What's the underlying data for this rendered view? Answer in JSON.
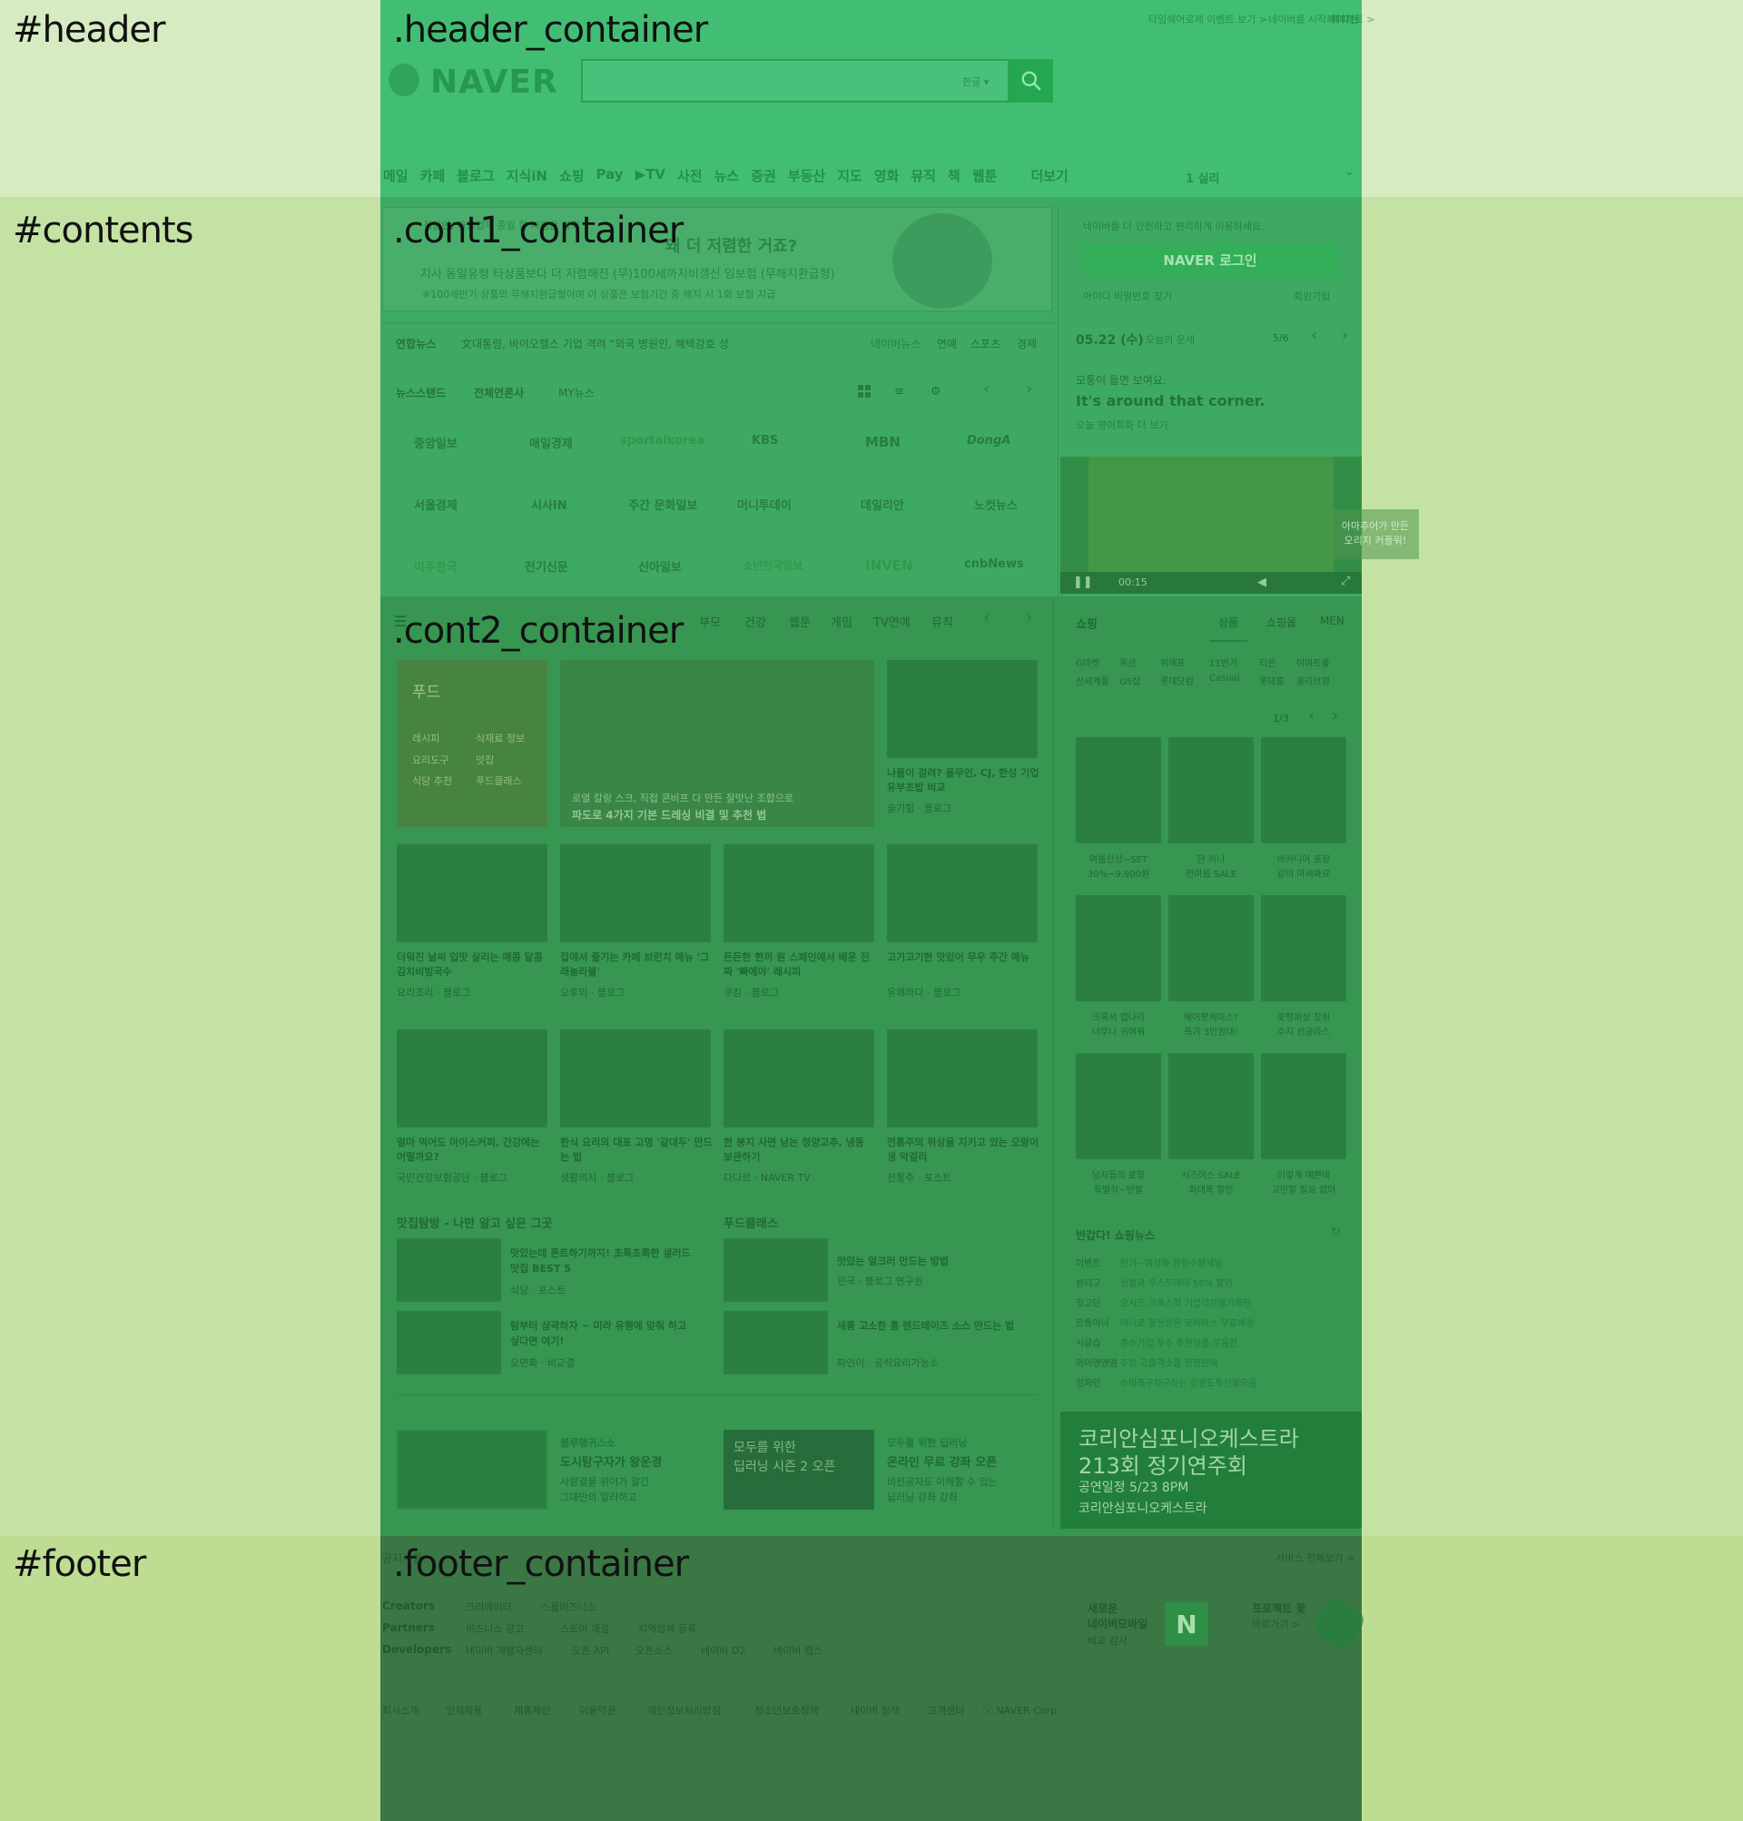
{
  "regions": {
    "header": "#header",
    "header_container": ".header_container",
    "contents": "#contents",
    "cont1_container": ".cont1_container",
    "cont2_container": ".cont2_container",
    "footer": "#footer",
    "footer_container": ".footer_container"
  },
  "colors": {
    "header_band": "#d6ebc1",
    "contents_band": "#c4e2a3",
    "footer_band": "#bedd93",
    "header_container": "#41be74",
    "cont1_container": "#3ea963",
    "cont2_container": "#379652",
    "footer_container": "#3a7745"
  },
  "header": {
    "top_links": [
      "타임쉐어로제 이벤트 보기 >",
      "네이버를 시작페이지로 >",
      "쥬니어네이버",
      "해피빈"
    ],
    "logo": "NAVER",
    "search_dropdown": "한글",
    "nav": [
      "메일",
      "카페",
      "블로그",
      "지식iN",
      "쇼핑",
      "Pay",
      "▶TV",
      "사전",
      "뉴스",
      "증권",
      "부동산",
      "지도",
      "영화",
      "뮤직",
      "책",
      "웹툰",
      "더보기"
    ],
    "nav_right": "1  실리"
  },
  "cont1": {
    "ad": {
      "line1": "직장인, 자영업자 종일 할 저렴한 가격",
      "line2": "왜 더 저렴한 거죠?",
      "line3": "지사 동일유형 타상품보다 더 저렴해진 (무)100세까지비갱신 임보험 (무해지환급형)",
      "line4": "※100세만기 상품의 무해지환급형이며 이 상품은 보험기간 중 해지 시 1회 보험 지급"
    },
    "login": {
      "notice": "네이버를 더 안전하고 편리하게 이용하세요.",
      "button": "NAVER 로그인",
      "find": "아이디 비밀번호 찾기",
      "signup": "회원가입"
    },
    "news_ticker": {
      "label": "연합뉴스",
      "headline": "文대통령, 바이오헬스 기업 격려 \"외국 병원인, 혜택강호 성",
      "sections": [
        "네이버뉴스",
        "연예",
        "스포츠",
        "경제"
      ]
    },
    "newsstand": {
      "label": "뉴스스탠드",
      "all_press": "전체언론사",
      "my_news": "MY뉴스",
      "press": [
        "중앙일보",
        "매일경제",
        "sportalkorea",
        "KBS",
        "MBN",
        "DongA",
        "서울경제",
        "시사IN",
        "주간 문화일보",
        "머니투데이",
        "데일리안",
        "노컷뉴스",
        "미주한국",
        "전기신문",
        "신아일보",
        "소년한국일보",
        "INVEN",
        "cnbNews"
      ]
    },
    "date_bar": {
      "date": "05.22 (수)",
      "weather_link": "오늘의 운세",
      "page": "5/6"
    },
    "english": {
      "kor": "모퉁이 돌면 보여요.",
      "eng": "It's around that corner.",
      "link": "오늘 영어회화 더 보기"
    },
    "video": {
      "time": "00:15"
    },
    "side_tag": [
      "아마추어가 만든",
      "오리지 커플워!"
    ]
  },
  "cont2": {
    "tabs": [
      "리빙",
      "푸드",
      "스포츠",
      "자동차",
      "책문화",
      "부모",
      "건강",
      "웹툰",
      "게임",
      "TV연예",
      "뮤직"
    ],
    "food_box": {
      "title": "푸드",
      "items": [
        "레시피",
        "식재료 정보",
        "요리도구",
        "맛집",
        "식당 추천",
        "푸드클래스"
      ]
    },
    "hero_caption": [
      "로열 칼링 스크, 직접 콘비프 다 만든 잘맛난 조합으로",
      "파도로 4가지 기본 드레싱 비결 및 추천 법"
    ],
    "side_card": {
      "title": "나물이 걸려? 올무인, CJ, 한성 기업 유부초밥 비교",
      "source": "슬기힘 · 블로그"
    },
    "cards": [
      {
        "title": "더워진 날씨 입맛 살리는 매콤 달콤 김치비빔국수",
        "source": "요리조리 · 블로그"
      },
      {
        "title": "집에서 즐기는 카페 브런치 메뉴 '그래놀라볼'",
        "source": "오후의 · 블로그"
      },
      {
        "title": "든든한 한끼 원 스페인에서 배운 진짜 '빠에야' 레시피",
        "source": "쿠킹 · 블로그"
      },
      {
        "title": "고기고기한 맛있어 무우 주간 메뉴",
        "source": "유쾌하다 · 블로그"
      },
      {
        "title": "얼마 먹어도 아이스커피, 간강에는 어떨까요?",
        "source": "국민건강보험공단 · 블로그"
      },
      {
        "title": "한식 요리의 대표 고명 '갈대두' 만드는 법",
        "source": "생활의지 · 블로그"
      },
      {
        "title": "한 봉지 사면 남는 청양고추, 냉동 보관하기",
        "source": "다다르 · NAVER TV"
      },
      {
        "title": "전통주의 위상을 지키고 있는 오랑이 생 막걸리",
        "source": "전통주 · 포스트"
      }
    ],
    "list_left_title": "맛집탐방 - 나만 알고 싶은 그곳",
    "list_left": [
      {
        "title": "맛있는데 폰트하기까지! 초록초록한 샐러드 맛집 BEST 5",
        "source": "식당 · 포스트"
      },
      {
        "title": "탐부터 샹곽하자 ~ 미라 유행에 맞춰 하고 싶다면 여기!",
        "source": "오면화 · 비교결"
      }
    ],
    "list_right_title": "푸드클래스",
    "list_right": [
      {
        "title": "맛있는 얼크러 만드는 방법",
        "source": "민국 · 블로그 연구원"
      },
      {
        "title": "새롱 고소한 홈 렌드테이즈 소스 만드는 법",
        "source": "파인이 · 공식요리가능소"
      }
    ],
    "promo_left": {
      "label": "블루랭귀스소",
      "title": "도시탐구자가 왕운경",
      "desc1": "사람곁을 위이가 알긴",
      "desc2": "그대만의 알러하고"
    },
    "promo_center": {
      "line1": "모두를 위한",
      "line2": "딥러닝 시즌 2 오픈"
    },
    "promo_right": {
      "label": "모두를 위한 딥러닝",
      "title": "온라인 무료 강좌 오픈",
      "desc1": "비전공자도 이해할 수 있는",
      "desc2": "딥러닝 강좌 강좌"
    },
    "shopping": {
      "title": "쇼핑",
      "tabs": [
        "상품",
        "쇼핑몰",
        "MEN"
      ],
      "malls_row1": [
        "G마켓",
        "옥션",
        "위메프",
        "11번가",
        "티몬",
        "이마트몰"
      ],
      "malls_row2": [
        "신세계몰",
        "GS샵",
        "롯데닷컴",
        "Casual",
        "롯데홈",
        "올리브영"
      ],
      "page": "1/3",
      "items": [
        {
          "l1": "여름신상~SET",
          "l2": "30%~9,900원"
        },
        {
          "l1": "단 하나",
          "l2": "전여름 SALE"
        },
        {
          "l1": "바카니어 포장",
          "l2": "같이 마셔봐요"
        },
        {
          "l1": "크록서 캡나라",
          "l2": "너무나 귀여워"
        },
        {
          "l1": "에어팟케이스?",
          "l2": "특가 3만원대!"
        },
        {
          "l1": "꽃펑퍼성 장원",
          "l2": "수지 선글라스"
        },
        {
          "l1": "남자들의 로망",
          "l2": "특발착~반팔"
        },
        {
          "l1": "시즈어스 SALE",
          "l2": "최대폭 할인"
        },
        {
          "l1": "이렇게 예쁜데",
          "l2": "고민할 필요 없어"
        }
      ],
      "news_title": "반갑다! 쇼핑뉴스",
      "news": [
        {
          "src": "이벤트",
          "text": "인기~여성화 한정수량세일"
        },
        {
          "src": "뷰티고",
          "text": "신발과 우스트레이 56% 할인"
        },
        {
          "src": "밍고딘",
          "text": "오시즈 크록스착 기업리모델기획전"
        },
        {
          "src": "르통아너",
          "text": "머니로 볼신상은 모하이스 무료배송"
        },
        {
          "src": "시글습",
          "text": "종소기업 우수 추천상품 모음전"
        },
        {
          "src": "아이앤앤엠",
          "text": "주방 고품격소품 한정판매"
        },
        {
          "src": "임파인",
          "text": "소비촉구차구하는 강원도특산물모음"
        }
      ]
    },
    "orchestra": {
      "line1": "코리안심포니오케스트라",
      "line2": "213회 정기연주회",
      "line3": "공연일정  5/23 8PM",
      "line4": "코리안심포니오케스트라"
    }
  },
  "footer": {
    "notice_label": "공지사항",
    "service_all": "서비스 전체보기 >",
    "rows": [
      {
        "label": "Creators",
        "links": [
          "크리에이터",
          "스몰비즈니스"
        ]
      },
      {
        "label": "Partners",
        "links": [
          "비즈니스 광고",
          "스토어 개설",
          "지역업체 등록"
        ]
      },
      {
        "label": "Developers",
        "links": [
          "네이버 개발자센터",
          "오픈 API",
          "오픈소스",
          "네이버 D2",
          "네이버 랩스"
        ]
      }
    ],
    "promo1": {
      "l1": "새로운",
      "l2": "네이버모바일",
      "l3": "비교 감사"
    },
    "promo2": {
      "l1": "프로젝트 꽃",
      "l2": "바로가기 >"
    },
    "bottom": [
      "회사소개",
      "인재채용",
      "제휴제안",
      "이용약관",
      "개인정보처리방침",
      "청소년보호정책",
      "네이버 정책",
      "고객센터",
      "ⓒ NAVER Corp."
    ]
  }
}
